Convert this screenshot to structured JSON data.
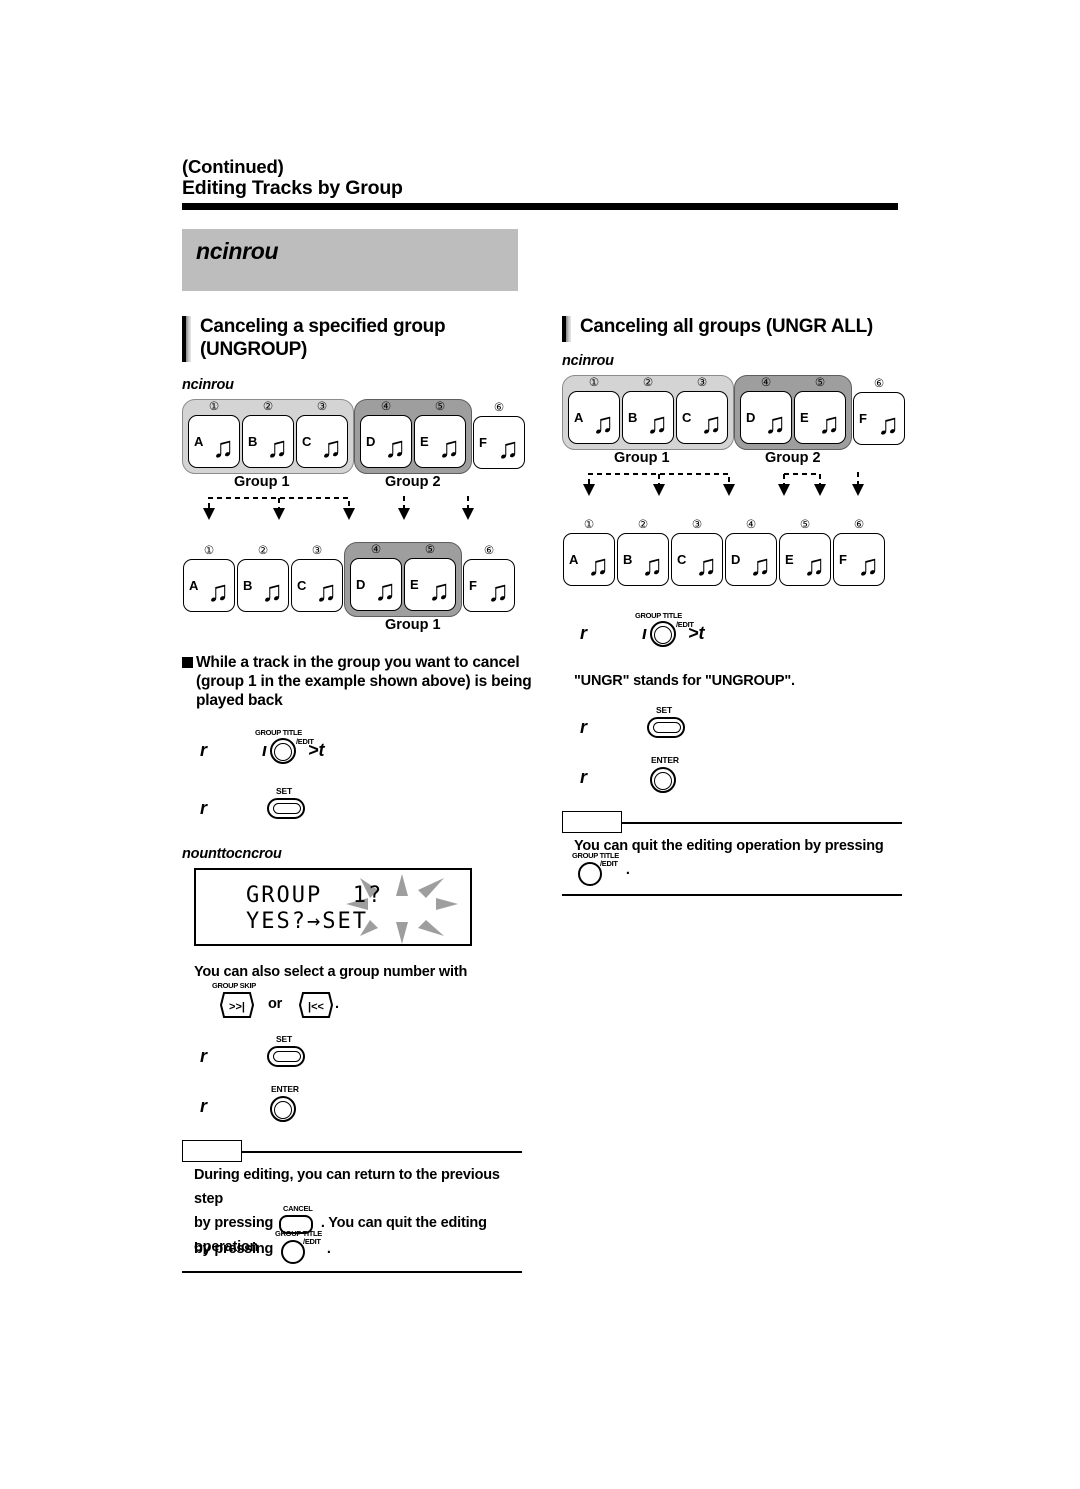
{
  "header": {
    "continued": "(Continued)",
    "title": "Editing Tracks by Group"
  },
  "banner": {
    "text": "ncinrou"
  },
  "left": {
    "heading": "Canceling a specified group (UNGROUP)",
    "example_label": "ncinrou",
    "diagram_before": {
      "numbers": [
        "①",
        "②",
        "③",
        "④",
        "⑤",
        "⑥"
      ],
      "letters": [
        "A",
        "B",
        "C",
        "D",
        "E",
        "F"
      ],
      "group1_label": "Group 1",
      "group2_label": "Group 2"
    },
    "diagram_after": {
      "numbers": [
        "①",
        "②",
        "③",
        "④",
        "⑤",
        "⑥"
      ],
      "letters": [
        "A",
        "B",
        "C",
        "D",
        "E",
        "F"
      ],
      "group1_label": "Group 1"
    },
    "instruction": "While a track in the group you want to cancel (group 1 in the example shown above) is being played back",
    "step1": {
      "prefix": "r",
      "mid": "ı",
      "suffix": ">t",
      "button": "GROUP TITLE",
      "button2": "/EDIT"
    },
    "step2": {
      "prefix": "r",
      "button": "SET"
    },
    "display_label": "nounttocncrou",
    "lcd": {
      "line1": "GROUP  1?",
      "line2": "YES?→SET"
    },
    "hint": "You can also select a group number with",
    "hint_buttons": {
      "skip_cap": "GROUP SKIP",
      "forward": ">>|",
      "or": "or",
      "back": "|<<",
      "period": "."
    },
    "step3": {
      "prefix": "r",
      "button": "SET"
    },
    "step4": {
      "prefix": "r",
      "button": "ENTER"
    },
    "memo": {
      "line1": "During editing, you can return to the previous step",
      "line2a": "by pressing",
      "cancel_cap": "CANCEL",
      "line2b": ". You can quit the editing operation",
      "line3a": "by pressing",
      "ge_cap1": "GROUP TITLE",
      "ge_cap2": "/EDIT",
      "line3b": "."
    }
  },
  "right": {
    "heading": "Canceling all groups (UNGR ALL)",
    "example_label": "ncinrou",
    "diagram_before": {
      "numbers": [
        "①",
        "②",
        "③",
        "④",
        "⑤",
        "⑥"
      ],
      "letters": [
        "A",
        "B",
        "C",
        "D",
        "E",
        "F"
      ],
      "group1_label": "Group 1",
      "group2_label": "Group 2"
    },
    "diagram_after": {
      "numbers": [
        "①",
        "②",
        "③",
        "④",
        "⑤",
        "⑥"
      ],
      "letters": [
        "A",
        "B",
        "C",
        "D",
        "E",
        "F"
      ]
    },
    "step1": {
      "prefix": "r",
      "mid": "ı",
      "suffix": ">t",
      "button": "GROUP TITLE",
      "button2": "/EDIT"
    },
    "note": "\"UNGR\" stands for \"UNGROUP\".",
    "step2": {
      "prefix": "r",
      "button": "SET"
    },
    "step3": {
      "prefix": "r",
      "button": "ENTER"
    },
    "memo": {
      "line1": "You can quit the editing operation by pressing",
      "ge_cap1": "GROUP TITLE",
      "ge_cap2": "/EDIT",
      "line2": "."
    }
  },
  "colors": {
    "group1_fill": "#d4d4d4",
    "group2_fill": "#9e9e9e",
    "banner_fill": "#bdbdbd",
    "ink": "#000000"
  },
  "glyphs": {
    "note": "♫"
  }
}
